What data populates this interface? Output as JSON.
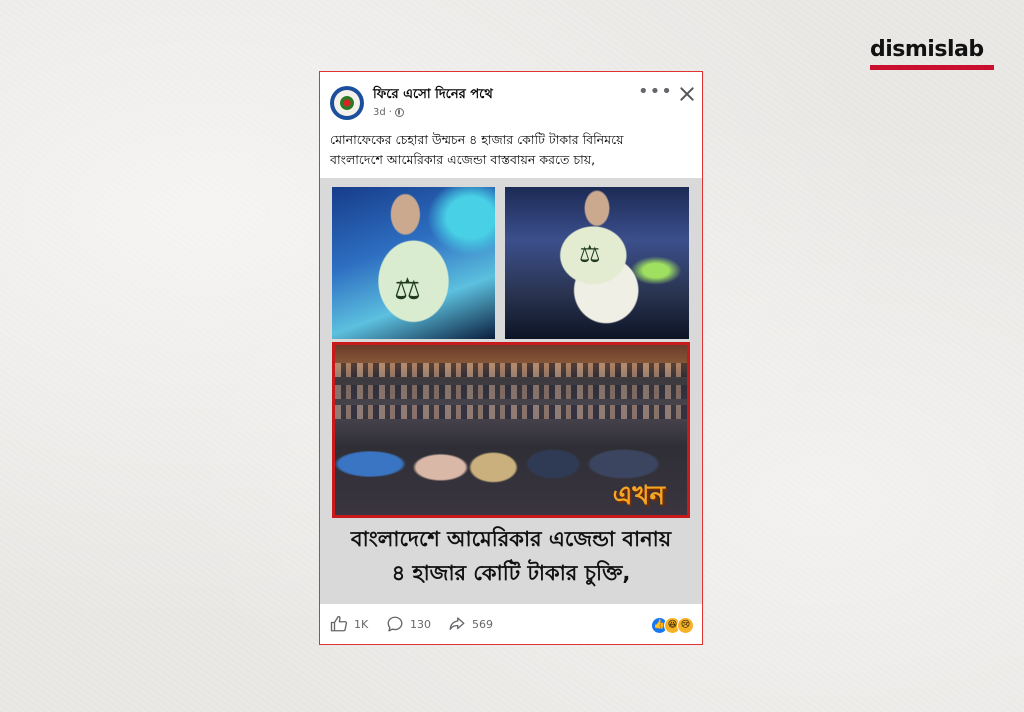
{
  "brand": {
    "name": "dismislab"
  },
  "post": {
    "page_name": "ফিরে এসো দিনের পথে",
    "time": "3d",
    "caption_line1": "মোনাফেকের চেহারা উম্মচন ৪ হাজার কোটি টাকার বিনিময়ে",
    "caption_line2": "বাংলাদেশে আমেরিকার এজেন্ডা বাস্তবায়ন করতে চায়,",
    "media": {
      "news_logo": "এখন",
      "headline_line1": "বাংলাদেশে আমেরিকার এজেন্ডা বানায়",
      "headline_line2": "৪ হাজার কোটি টাকার চুক্তি,"
    },
    "actions": {
      "likes": "1K",
      "comments": "130",
      "shares": "569"
    },
    "icons": [
      "globe-icon",
      "more-icon",
      "close-icon",
      "like-icon",
      "comment-icon",
      "share-icon"
    ]
  }
}
